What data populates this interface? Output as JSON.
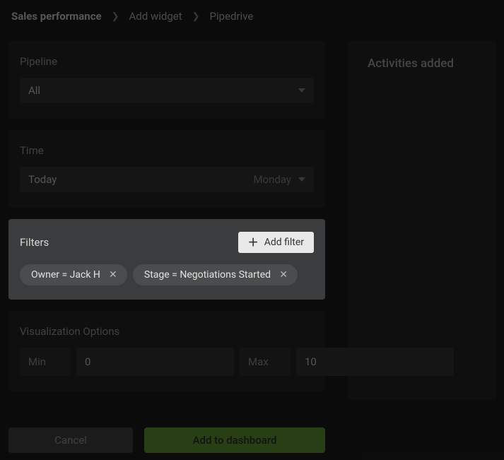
{
  "breadcrumb": {
    "root": "Sales performance",
    "mid": "Add widget",
    "leaf": "Pipedrive"
  },
  "pipeline": {
    "label": "Pipeline",
    "value": "All"
  },
  "time": {
    "label": "Time",
    "value": "Today",
    "hint": "Monday"
  },
  "filters": {
    "label": "Filters",
    "add_label": "Add filter",
    "chips": [
      {
        "text": "Owner  =  Jack H"
      },
      {
        "text": "Stage  =  Negotiations Started"
      }
    ]
  },
  "viz": {
    "label": "Visualization Options",
    "min_label": "Min",
    "min_value": "0",
    "max_label": "Max",
    "max_value": "10"
  },
  "footer": {
    "cancel": "Cancel",
    "submit": "Add to dashboard"
  },
  "right_panel": {
    "title": "Activities added"
  }
}
